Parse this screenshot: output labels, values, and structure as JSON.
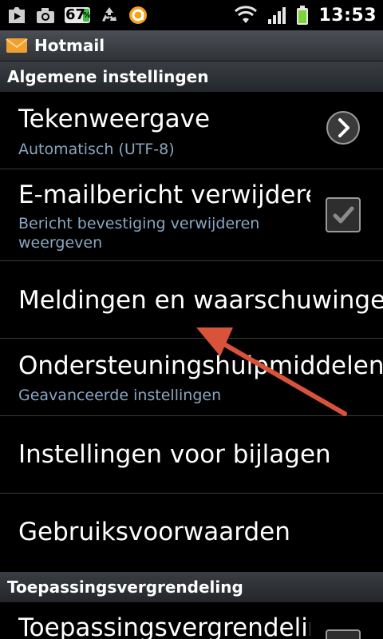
{
  "status_bar": {
    "battery_badge": "67",
    "battery_badge_unit": "%",
    "time": "13:53"
  },
  "app_bar": {
    "title": "Hotmail",
    "icon": "envelope-icon"
  },
  "sections": {
    "general": "Algemene instellingen",
    "lock": "Toepassingsvergrendeling"
  },
  "settings": {
    "char_display": {
      "title": "Tekenweergave",
      "subtitle": "Automatisch (UTF-8)"
    },
    "email_delete": {
      "title": "E-mailbericht verwijderen",
      "subtitle_line1": "Bericht bevestiging verwijderen",
      "subtitle_line2": "weergeven",
      "checked": true
    },
    "notifications": {
      "title": "Meldingen en waarschuwingen"
    },
    "support_tools": {
      "title": "Ondersteuningshulpmiddelen",
      "subtitle": "Geavanceerde instellingen"
    },
    "attachments": {
      "title": "Instellingen voor bijlagen"
    },
    "terms": {
      "title": "Gebruiksvoorwaarden"
    },
    "app_lock": {
      "title": "Toepassingsvergrendeling"
    }
  },
  "colors": {
    "subtitle": "#8aa6c1",
    "annotation_arrow": "#d9533a"
  }
}
